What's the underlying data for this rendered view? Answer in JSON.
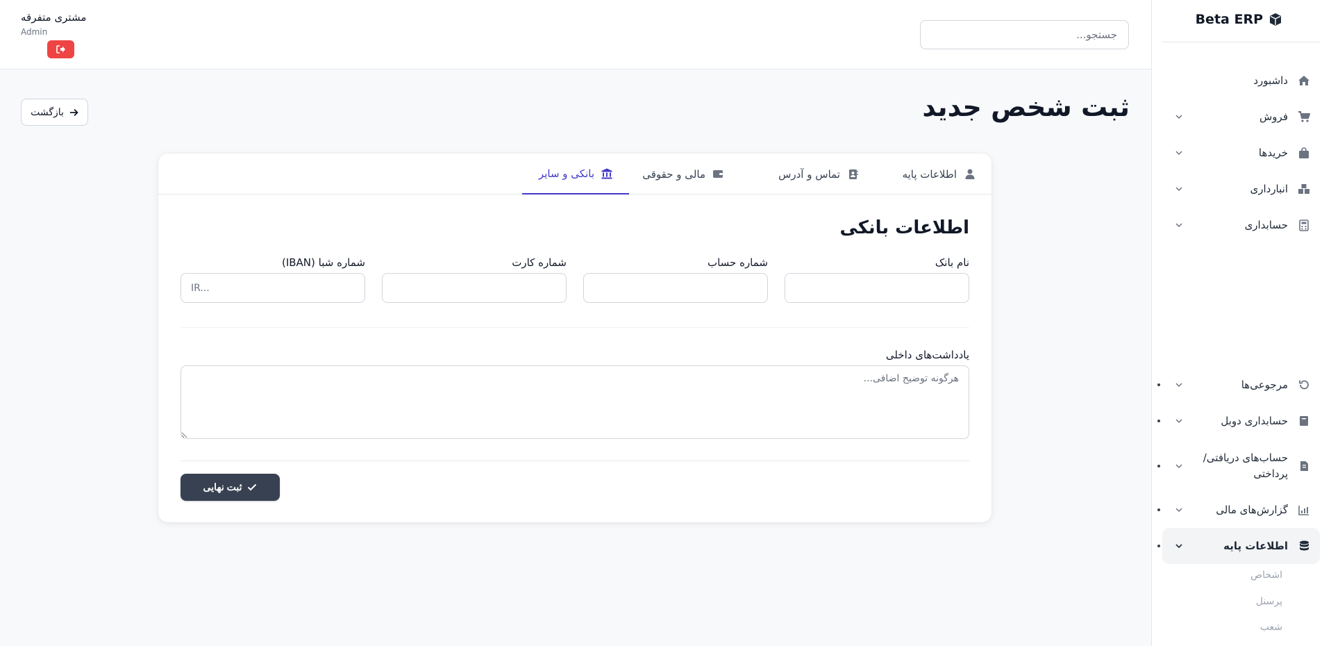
{
  "app": {
    "brand": "Beta ERP"
  },
  "header": {
    "search_placeholder": "جستجو...",
    "user_name": "مشتری متفرقه",
    "user_role": "Admin"
  },
  "sidebar": {
    "items": [
      {
        "label": "داشبورد",
        "icon": "home-icon",
        "has_children": false
      },
      {
        "label": "فروش",
        "icon": "cart-icon",
        "has_children": true
      },
      {
        "label": "خریدها",
        "icon": "shopping-bag-icon",
        "has_children": true
      },
      {
        "label": "انبارداری",
        "icon": "boxes-icon",
        "has_children": true
      },
      {
        "label": "حسابداری",
        "icon": "calculator-icon",
        "has_children": true
      },
      {
        "label": "مرجوعی‌ها",
        "icon": "undo-icon",
        "has_children": true
      },
      {
        "label": "حسابداری دوبل",
        "icon": "book-icon",
        "has_children": true
      },
      {
        "label": "حساب‌های دریافتی/ پرداختی",
        "icon": "invoice-icon",
        "has_children": true
      },
      {
        "label": "گزارش‌های مالی",
        "icon": "chart-icon",
        "has_children": true
      },
      {
        "label": "اطلاعات پایه",
        "icon": "database-icon",
        "has_children": true,
        "active": true
      }
    ],
    "sub_items": [
      "اشخاص",
      "پرسنل",
      "شعب"
    ]
  },
  "page": {
    "title": "ثبت شخص جدید",
    "back_label": "بازگشت"
  },
  "tabs": [
    {
      "label": "اطلاعات پایه",
      "icon": "user-icon"
    },
    {
      "label": "تماس و آدرس",
      "icon": "address-book-icon"
    },
    {
      "label": "مالی و حقوقی",
      "icon": "wallet-icon"
    },
    {
      "label": "بانکی و سایر",
      "icon": "bank-icon",
      "active": true
    }
  ],
  "form": {
    "section_title": "اطلاعات بانکی",
    "fields": [
      {
        "label": "نام بانک",
        "placeholder": "",
        "value": ""
      },
      {
        "label": "شماره حساب",
        "placeholder": "",
        "value": ""
      },
      {
        "label": "شماره کارت",
        "placeholder": "",
        "value": ""
      },
      {
        "label": "شماره شبا (IBAN)",
        "placeholder": "IR...",
        "value": ""
      }
    ],
    "notes_label": "یادداشت‌های داخلی",
    "notes_placeholder": "هرگونه توضیح اضافی...",
    "submit_label": "ثبت نهایی"
  },
  "colors": {
    "accent": "#4338ca",
    "danger": "#ef4444",
    "primary_button": "#374151"
  }
}
